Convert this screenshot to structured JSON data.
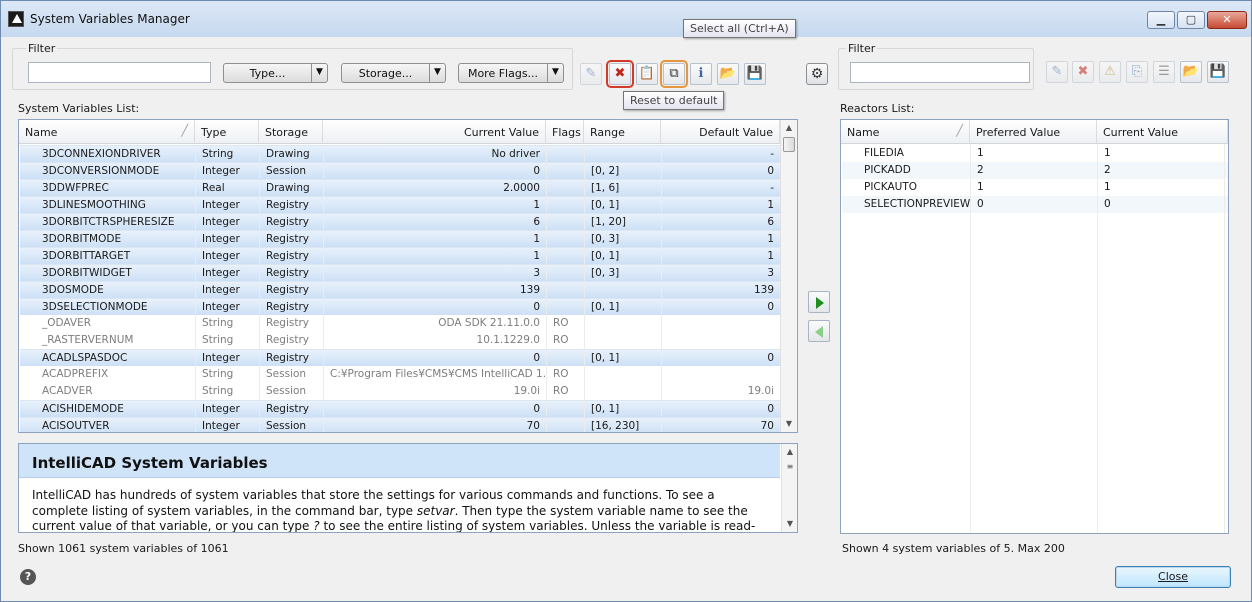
{
  "window": {
    "title": "System Variables Manager",
    "min_label": "▁",
    "max_label": "▢",
    "close_label": "✕"
  },
  "left_filter": {
    "label": "Filter",
    "value": "",
    "type_label": "Type...",
    "storage_label": "Storage...",
    "more_flags_label": "More Flags..."
  },
  "toolbar": {
    "tooltip_select_all": "Select all (Ctrl+A)",
    "tooltip_reset": "Reset to default"
  },
  "sysvars": {
    "title": "System Variables List:",
    "columns": [
      "Name",
      "Type",
      "Storage",
      "Current Value",
      "Flags",
      "Range",
      "Default Value"
    ],
    "rows": [
      {
        "name": "3DCONNEXIONDRIVER",
        "type": "String",
        "storage": "Drawing",
        "current": "No driver",
        "flags": "",
        "range": "",
        "default": "-",
        "sel": true
      },
      {
        "name": "3DCONVERSIONMODE",
        "type": "Integer",
        "storage": "Session",
        "current": "0",
        "flags": "",
        "range": "[0, 2]",
        "default": "0",
        "sel": true
      },
      {
        "name": "3DDWFPREC",
        "type": "Real",
        "storage": "Drawing",
        "current": "2.0000",
        "flags": "",
        "range": "[1, 6]",
        "default": "-",
        "sel": true
      },
      {
        "name": "3DLINESMOOTHING",
        "type": "Integer",
        "storage": "Registry",
        "current": "1",
        "flags": "",
        "range": "[0, 1]",
        "default": "1",
        "sel": true
      },
      {
        "name": "3DORBITCTRSPHERESIZE",
        "type": "Integer",
        "storage": "Registry",
        "current": "6",
        "flags": "",
        "range": "[1, 20]",
        "default": "6",
        "sel": true
      },
      {
        "name": "3DORBITMODE",
        "type": "Integer",
        "storage": "Registry",
        "current": "1",
        "flags": "",
        "range": "[0, 3]",
        "default": "1",
        "sel": true
      },
      {
        "name": "3DORBITTARGET",
        "type": "Integer",
        "storage": "Registry",
        "current": "1",
        "flags": "",
        "range": "[0, 1]",
        "default": "1",
        "sel": true
      },
      {
        "name": "3DORBITWIDGET",
        "type": "Integer",
        "storage": "Registry",
        "current": "3",
        "flags": "",
        "range": "[0, 3]",
        "default": "3",
        "sel": true
      },
      {
        "name": "3DOSMODE",
        "type": "Integer",
        "storage": "Registry",
        "current": "139",
        "flags": "",
        "range": "",
        "default": "139",
        "sel": true
      },
      {
        "name": "3DSELECTIONMODE",
        "type": "Integer",
        "storage": "Registry",
        "current": "0",
        "flags": "",
        "range": "[0, 1]",
        "default": "0",
        "sel": true
      },
      {
        "name": "_ODAVER",
        "type": "String",
        "storage": "Registry",
        "current": "ODA SDK 21.11.0.0",
        "flags": "RO",
        "range": "",
        "default": "",
        "sel": false
      },
      {
        "name": "_RASTERVERNUM",
        "type": "String",
        "storage": "Registry",
        "current": "10.1.1229.0",
        "flags": "RO",
        "range": "",
        "default": "",
        "sel": false
      },
      {
        "name": "ACADLSPASDOC",
        "type": "Integer",
        "storage": "Registry",
        "current": "0",
        "flags": "",
        "range": "[0, 1]",
        "default": "0",
        "sel": true
      },
      {
        "name": "ACADPREFIX",
        "type": "String",
        "storage": "Session",
        "current": "C:¥Program Files¥CMS¥CMS IntelliCAD 1...",
        "flags": "RO",
        "range": "",
        "default": "",
        "sel": false
      },
      {
        "name": "ACADVER",
        "type": "String",
        "storage": "Session",
        "current": "19.0i",
        "flags": "RO",
        "range": "",
        "default": "19.0i",
        "sel": false
      },
      {
        "name": "ACISHIDEMODE",
        "type": "Integer",
        "storage": "Registry",
        "current": "0",
        "flags": "",
        "range": "[0, 1]",
        "default": "0",
        "sel": true
      },
      {
        "name": "ACISOUTVER",
        "type": "Integer",
        "storage": "Session",
        "current": "70",
        "flags": "",
        "range": "[16, 230]",
        "default": "70",
        "sel": true
      }
    ]
  },
  "help": {
    "title": "IntelliCAD System Variables",
    "p1": "IntelliCAD has hundreds of system variables that store the settings for various commands and functions. To see a complete listing of system variables, in the command bar, type ",
    "p1_em": "setvar",
    "p2": ". Then type the system variable name to see the current value of that variable, or you can type ",
    "p2_em": "?",
    "p3": " to see the entire listing of system variables. Unless the variable is read-only, you can also change its value in the"
  },
  "left_status": "Shown 1061 system variables of 1061",
  "right_filter": {
    "label": "Filter",
    "value": ""
  },
  "reactors": {
    "title": "Reactors List:",
    "columns": [
      "Name",
      "Preferred Value",
      "Current Value"
    ],
    "rows": [
      {
        "name": "FILEDIA",
        "preferred": "1",
        "current": "1"
      },
      {
        "name": "PICKADD",
        "preferred": "2",
        "current": "2"
      },
      {
        "name": "PICKAUTO",
        "preferred": "1",
        "current": "1"
      },
      {
        "name": "SELECTIONPREVIEW",
        "preferred": "0",
        "current": "0"
      }
    ]
  },
  "right_status": "Shown 4 system variables of 5. Max 200",
  "close_button": "Close",
  "help_icon": "?"
}
